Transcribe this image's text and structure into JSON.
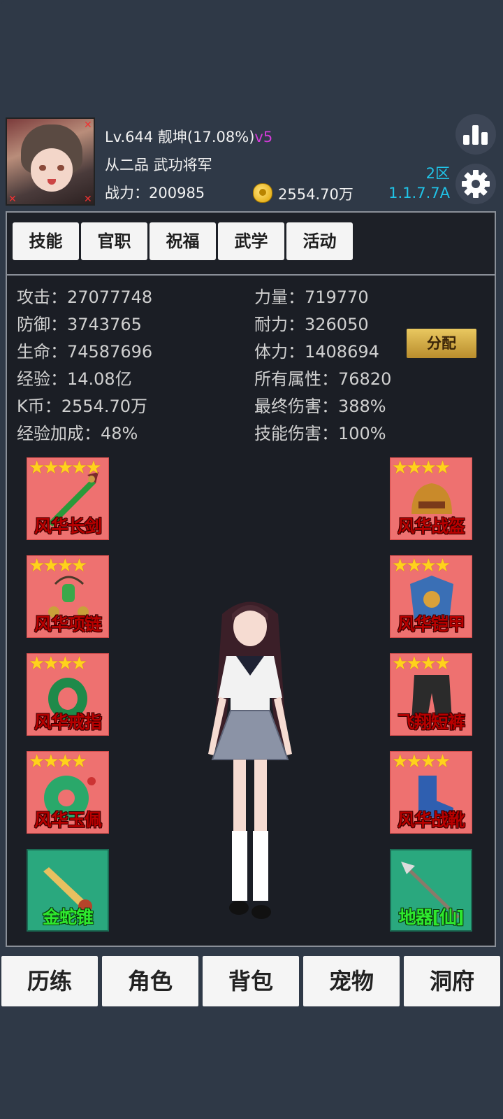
{
  "header": {
    "level_line": "Lv.644 靓坤(17.08%)",
    "vip": "v5",
    "rank": "从二品  武功将军",
    "power_label": "战力：200985",
    "currency": "2554.70万",
    "server": "2区",
    "version": "1.1.7.7A",
    "icons": {
      "stats": "bar-chart-icon",
      "settings": "gear-icon",
      "coin": "coin-icon"
    }
  },
  "tabs": [
    "技能",
    "官职",
    "祝福",
    "武学",
    "活动"
  ],
  "stats_left": [
    "攻击：27077748",
    "防御：3743765",
    "生命：74587696",
    "经验：14.08亿",
    "K币：2554.70万",
    "经验加成：48%"
  ],
  "stats_right": [
    "力量：719770",
    "耐力：326050",
    "体力：1408694",
    "所有属性：76820",
    "最终伤害：388%",
    "技能伤害：100%"
  ],
  "allocate_label": "分配",
  "equipment_left": [
    {
      "name": "风华长剑",
      "stars": 5,
      "icon": "sword-icon"
    },
    {
      "name": "风华项链",
      "stars": 4,
      "icon": "necklace-icon"
    },
    {
      "name": "风华戒指",
      "stars": 4,
      "icon": "ring-icon"
    },
    {
      "name": "风华玉佩",
      "stars": 4,
      "icon": "jade-pendant-icon"
    },
    {
      "name": "金蛇锥",
      "stars": 0,
      "icon": "golden-awl-icon"
    }
  ],
  "equipment_right": [
    {
      "name": "风华战盔",
      "stars": 4,
      "icon": "helmet-icon"
    },
    {
      "name": "风华铠甲",
      "stars": 4,
      "icon": "armor-icon"
    },
    {
      "name": "飞翔短裤",
      "stars": 4,
      "icon": "pants-icon"
    },
    {
      "name": "风华战靴",
      "stars": 4,
      "icon": "boots-icon"
    },
    {
      "name": "地器[仙]",
      "stars": 0,
      "icon": "trident-icon"
    }
  ],
  "bottom_nav": [
    "历练",
    "角色",
    "背包",
    "宠物",
    "洞府"
  ],
  "colors": {
    "background": "#2f3947",
    "panel": "#1b1e25",
    "equip_red": "#ee7170",
    "equip_green": "#2aa87e",
    "vip": "#d33bd8",
    "server_text": "#20c4e8",
    "star": "#ffd21c"
  }
}
